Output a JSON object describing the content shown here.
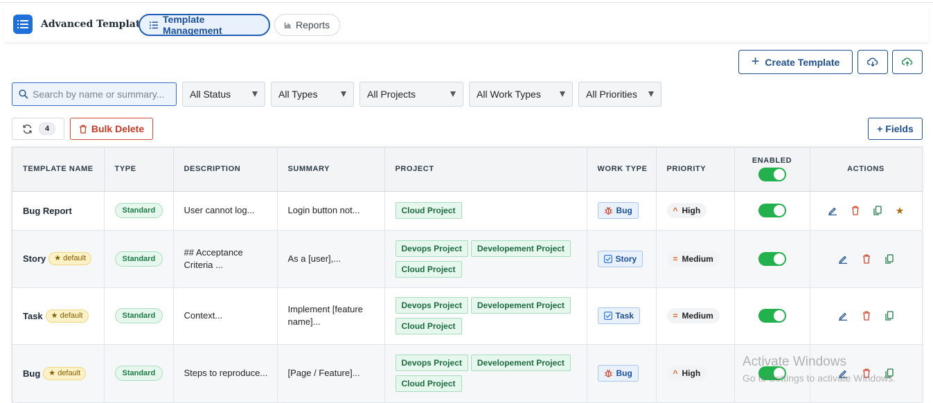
{
  "app": {
    "title": "Advanced Template"
  },
  "nav": {
    "tabs": [
      {
        "label": "Template Management",
        "active": true
      },
      {
        "label": "Reports",
        "active": false
      }
    ]
  },
  "toolbar": {
    "create_label": "Create Template",
    "bulk_delete_label": "Bulk Delete",
    "fields_label": "+ Fields",
    "count": "4"
  },
  "search": {
    "placeholder": "Search by name or summary..."
  },
  "filters": [
    "All Status",
    "All Types",
    "All Projects",
    "All Work Types",
    "All Priorities"
  ],
  "table": {
    "columns": [
      "TEMPLATE NAME",
      "TYPE",
      "DESCRIPTION",
      "SUMMARY",
      "PROJECT",
      "WORK TYPE",
      "PRIORITY",
      "ENABLED",
      "ACTIONS"
    ],
    "rows": [
      {
        "name": "Bug Report",
        "default": "",
        "type": "Standard",
        "description": "User cannot log...",
        "summary": "Login button not...",
        "projects": [
          "Cloud Project"
        ],
        "work_type": "Bug",
        "work_type_icon": "bug-icon",
        "priority": "High",
        "priority_icon": "chevron-up-icon",
        "enabled": true
      },
      {
        "name": "Story",
        "default": "★ default",
        "type": "Standard",
        "description": "## Acceptance Criteria ...",
        "summary": "As a [user],...",
        "projects": [
          "Devops Project",
          "Developement Project",
          "Cloud Project"
        ],
        "work_type": "Story",
        "work_type_icon": "checkbox-icon",
        "priority": "Medium",
        "priority_icon": "equals-icon",
        "enabled": true
      },
      {
        "name": "Task",
        "default": "★ default",
        "type": "Standard",
        "description": "Context...",
        "summary": "Implement [feature name]...",
        "projects": [
          "Devops Project",
          "Developement Project",
          "Cloud Project"
        ],
        "work_type": "Task",
        "work_type_icon": "checkbox-icon",
        "priority": "Medium",
        "priority_icon": "equals-icon",
        "enabled": true
      },
      {
        "name": "Bug",
        "default": "★ default",
        "type": "Standard",
        "description": "Steps to reproduce...",
        "summary": "[Page / Feature]...",
        "projects": [
          "Devops Project",
          "Developement Project",
          "Cloud Project"
        ],
        "work_type": "Bug",
        "work_type_icon": "bug-icon",
        "priority": "High",
        "priority_icon": "chevron-up-icon",
        "enabled": true
      }
    ]
  },
  "watermark": {
    "line1": "Activate Windows",
    "line2": "Go to Settings to activate Windows."
  },
  "colors": {
    "primary": "#1e4f8f",
    "accent": "#1e6fd9",
    "danger": "#c73a22",
    "success": "#22b14c"
  }
}
